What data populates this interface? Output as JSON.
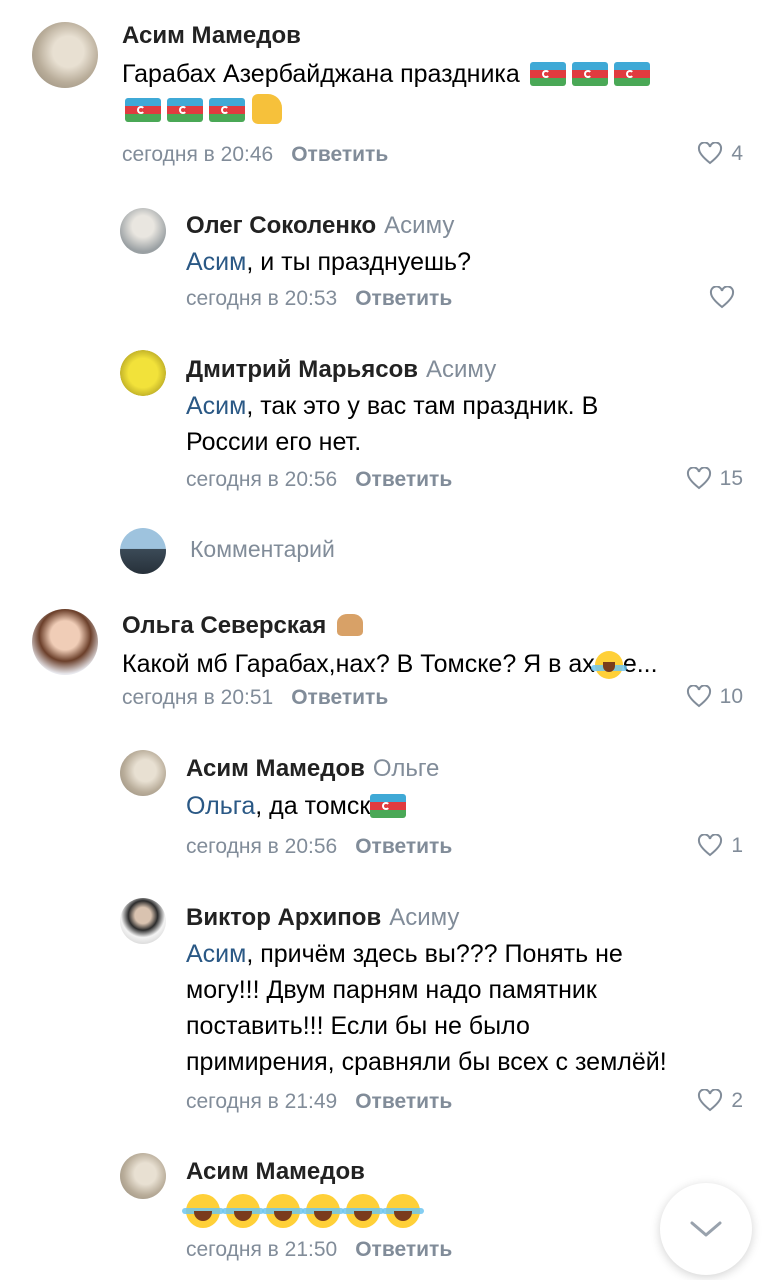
{
  "comments": [
    {
      "author": "Асим Мамедов",
      "text_line1": "Гарабах Азербайджана праздника",
      "time": "сегодня в 20:46",
      "reply": "Ответить",
      "likes": "4"
    },
    {
      "author": "Олег Соколенко",
      "reply_to": "Асиму",
      "mention": "Асим",
      "text": ", и ты празднуешь?",
      "time": "сегодня в 20:53",
      "reply": "Ответить",
      "likes": ""
    },
    {
      "author": "Дмитрий Марьясов",
      "reply_to": "Асиму",
      "mention": "Асим",
      "text_line1": ", так это у вас там праздник. В",
      "text_line2": "России его нет.",
      "time": "сегодня в 20:56",
      "reply": "Ответить",
      "likes": "15"
    },
    {
      "author": "Ольга Северская",
      "text_before": "Какой мб Гарабах,нах? В Томске? Я в ах",
      "text_after": "е...",
      "time": "сегодня в 20:51",
      "reply": "Ответить",
      "likes": "10"
    },
    {
      "author": "Асим Мамедов",
      "reply_to": "Ольге",
      "mention": "Ольга",
      "text": ", да томск",
      "time": "сегодня в 20:56",
      "reply": "Ответить",
      "likes": "1"
    },
    {
      "author": "Виктор Архипов",
      "reply_to": "Асиму",
      "mention": "Асим",
      "text_line1": ", причём здесь вы??? Понять не",
      "text_line2": "могу!!!  Двум парням надо памятник",
      "text_line3": "поставить!!! Если бы не было",
      "text_line4": "примирения, сравняли бы всех с землёй!",
      "time": "сегодня в 21:49",
      "reply": "Ответить",
      "likes": "2"
    },
    {
      "author": "Асим Мамедов",
      "time": "сегодня в 21:50",
      "reply": "Ответить"
    }
  ],
  "comment_input": {
    "placeholder": "Комментарий"
  },
  "icons": {
    "like": "heart-icon",
    "scroll": "chevron-down-icon",
    "flag": "azerbaijan-flag-icon"
  },
  "colors": {
    "meta": "#818c99",
    "mention": "#2a5885"
  }
}
